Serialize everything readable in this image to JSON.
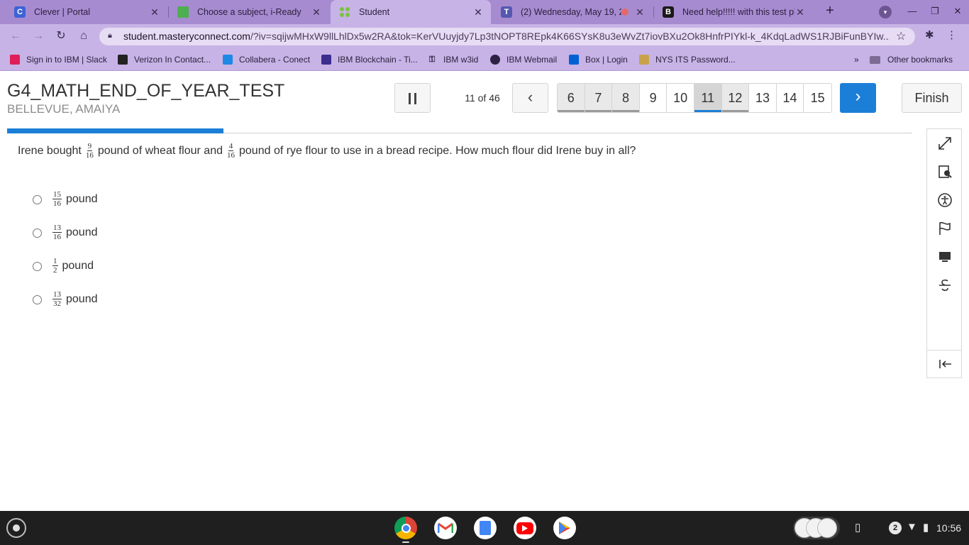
{
  "browser": {
    "tabs": [
      {
        "title": "Clever | Portal",
        "favicon": "C",
        "favicon_color": "#3c63d6"
      },
      {
        "title": "Choose a subject, i-Ready",
        "favicon": "",
        "favicon_color": "#4caf50"
      },
      {
        "title": "Student",
        "favicon": "",
        "favicon_color": "#7cc242"
      },
      {
        "title": "(2) Wednesday, May 19, 2",
        "favicon": "T",
        "favicon_color": "#5558af"
      },
      {
        "title": "Need help!!!!! with this test pls",
        "favicon": "B",
        "favicon_color": "#1a1a1a"
      }
    ],
    "active_tab_index": 2,
    "url_host": "student.masteryconnect.com",
    "url_rest": "/?iv=sqijwMHxW9llLhlDx5w2RA&tok=KerVUuyjdy7Lp3tNOPT8REpk4K66SYsK8u3eWvZt7iovBXu2Ok8HnfrPIYkl-k_4KdqLadWS1RJBiFunBYIw...",
    "bookmarks": [
      {
        "label": "Sign in to IBM | Slack",
        "icon": "slack-icon"
      },
      {
        "label": "Verizon In Contact...",
        "icon": "verizon-icon"
      },
      {
        "label": "Collabera - Conect",
        "icon": "collabera-icon"
      },
      {
        "label": "IBM Blockchain - Ti...",
        "icon": "ibm-blockchain-icon"
      },
      {
        "label": "IBM w3id",
        "icon": "key-icon"
      },
      {
        "label": "IBM Webmail",
        "icon": "webmail-icon"
      },
      {
        "label": "Box | Login",
        "icon": "box-icon"
      },
      {
        "label": "NYS ITS Password...",
        "icon": "nys-icon"
      }
    ],
    "more_bookmarks": "»",
    "other_bookmarks": "Other bookmarks"
  },
  "test": {
    "title": "G4_MATH_END_OF_YEAR_TEST",
    "student_name": "BELLEVUE, AMAIYA",
    "counter": "11 of 46",
    "progress_fraction": 0.239,
    "questions": [
      {
        "num": "6",
        "state": "answered"
      },
      {
        "num": "7",
        "state": "answered"
      },
      {
        "num": "8",
        "state": "answered"
      },
      {
        "num": "9",
        "state": "unanswered"
      },
      {
        "num": "10",
        "state": "unanswered"
      },
      {
        "num": "11",
        "state": "current"
      },
      {
        "num": "12",
        "state": "answered"
      },
      {
        "num": "13",
        "state": "unanswered"
      },
      {
        "num": "14",
        "state": "unanswered"
      },
      {
        "num": "15",
        "state": "unanswered"
      }
    ],
    "finish_label": "Finish"
  },
  "question": {
    "part1": "Irene bought",
    "frac1": {
      "num": "9",
      "den": "16"
    },
    "part2": "pound of wheat flour and",
    "frac2": {
      "num": "4",
      "den": "16"
    },
    "part3": "pound of rye flour to use in a bread recipe.  How much flour did Irene buy in all?",
    "choices": [
      {
        "num": "15",
        "den": "16",
        "unit": "pound"
      },
      {
        "num": "13",
        "den": "16",
        "unit": "pound"
      },
      {
        "num": "1",
        "den": "2",
        "unit": "pound"
      },
      {
        "num": "13",
        "den": "32",
        "unit": "pound"
      }
    ]
  },
  "tools": [
    "expand-icon",
    "reference-icon",
    "accessibility-icon",
    "flag-icon",
    "calculator-icon",
    "strikethrough-icon",
    "collapse-panel-icon"
  ],
  "shelf": {
    "apps": [
      "chrome-icon",
      "gmail-icon",
      "docs-icon",
      "youtube-icon",
      "play-store-icon"
    ],
    "notification_count": "2",
    "time": "10:56"
  },
  "colors": {
    "accent": "#1c7fd7",
    "tab_strip": "#a78bd0",
    "toolbar": "#c7b3e6"
  }
}
